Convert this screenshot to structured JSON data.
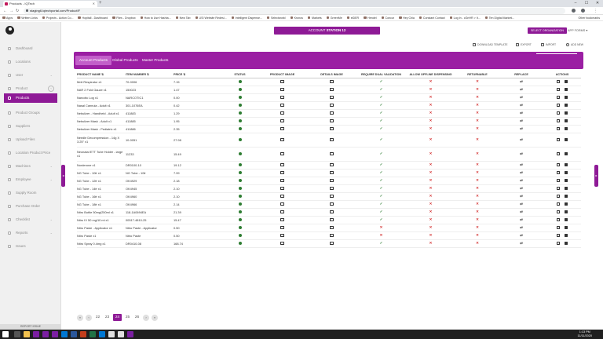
{
  "browser": {
    "tab_title": "Products - IQTech",
    "url": "staging6.iqtechportal.com/ProductIF",
    "bookmarks": [
      "Apps",
      "Written Links",
      "Projects - Action Co...",
      "Hopitall - Dashboard",
      "Files - Dropbox",
      "How to Use Hashta...",
      "New Tab",
      "USI Website Redesi...",
      "Intelligent Dispense...",
      "Selectworld",
      "Kronos",
      "Markets",
      "GreenMe",
      "eiDER",
      "Hendel",
      "Concur",
      "Hey Chia",
      "Constant Contact",
      "Log In - cGnHR > It...",
      "Ten Digital Marketi..."
    ],
    "other_bookmarks": "Other bookmarks"
  },
  "sidebar": {
    "items": [
      {
        "label": "Dashboard"
      },
      {
        "label": "Locations"
      },
      {
        "label": "User"
      },
      {
        "label": "Product"
      },
      {
        "label": "Products"
      },
      {
        "label": "Product Groups"
      },
      {
        "label": "Suppliers"
      },
      {
        "label": "Upload Files"
      },
      {
        "label": "Location Product Price"
      },
      {
        "label": "Machines"
      },
      {
        "label": "Employee"
      },
      {
        "label": "Supply Room"
      },
      {
        "label": "Purchase Order"
      },
      {
        "label": "Checklist"
      },
      {
        "label": "Reports"
      },
      {
        "label": "Issues"
      }
    ],
    "report_issue": "REPORT ISSUE"
  },
  "header": {
    "account_label": "ACCOUNT",
    "account_value": "STATION 12",
    "select_org": "SELECT ORGANIZATION",
    "app_forms": "APP FORMS ▾"
  },
  "toolbar": {
    "download": "DOWNLOAD TEMPLATE",
    "export": "EXPORT",
    "import": "IMPORT",
    "add_new": "ADD NEW"
  },
  "tabs": [
    "Account Products",
    "Global Products",
    "Master Products"
  ],
  "search_label": "Search",
  "columns": [
    "PRODUCT NAME ⇅",
    "ITEM NUMBER ⇅",
    "PRICE ⇅",
    "STATUS",
    "PRODUCT IMAGE",
    "DETAILS IMAGE",
    "REQUIRE DUAL VALIDATION",
    "ALLOW OFFLINE DISPENSING",
    "RETURNABLE",
    "REPLACE",
    "ACTIONS"
  ],
  "rows": [
    {
      "name": "Mntl Respirator x1",
      "item": "70-0006",
      "price": "7.15",
      "dual": true
    },
    {
      "name": "NAR 2 Fold Gauze x1",
      "item": "150023",
      "price": "1.47",
      "dual": true
    },
    {
      "name": "Narcotic Log x1",
      "item": "NARCOTIC1",
      "price": "0.00",
      "dual": true
    },
    {
      "name": "Nasal Cannula - Adult x1",
      "item": "301-1076EA",
      "price": "0.42",
      "dual": true
    },
    {
      "name": "Nebulizer - Handheld - Adult x1",
      "item": "411883",
      "price": "1.29",
      "dual": true
    },
    {
      "name": "Nebulizer Mask - Adult x1",
      "item": "411885",
      "price": "1.95",
      "dual": true
    },
    {
      "name": "Nebulizer Mask - Pediatric x1",
      "item": "411886",
      "price": "2.35",
      "dual": true
    },
    {
      "name": "Needle Decompression - 14g X 3.25\" x1",
      "item": "10-0051",
      "price": "27.98",
      "dual": true,
      "tall": true
    },
    {
      "name": "Neonatal ETT Tube Holder - large x1",
      "item": "11233",
      "price": "15.49",
      "dual": true,
      "tall": true
    },
    {
      "name": "Norderone x1",
      "item": "DR0100-10",
      "price": "19.12",
      "dual": true
    },
    {
      "name": "NG Tube - 10fr x1",
      "item": "NG Tube - 10fr",
      "price": "7.99",
      "dual": true
    },
    {
      "name": "NG Tube - 12fr x1",
      "item": "OK4929",
      "price": "2.18",
      "dual": true
    },
    {
      "name": "NG Tube - 14fr x1",
      "item": "OK4945",
      "price": "2.10",
      "dual": true
    },
    {
      "name": "NG Tube - 16fr x1",
      "item": "OK4960",
      "price": "2.10",
      "dual": true
    },
    {
      "name": "NG Tube - 18fr x1",
      "item": "OK4966",
      "price": "2.14",
      "dual": true
    },
    {
      "name": "Nitro Bottle 50mg/250ml x1",
      "item": "118-1A0694EA",
      "price": "21.39",
      "dual": true
    },
    {
      "name": "Nitro IV 50 mg/10 ml x1",
      "item": "00517-4810-25",
      "price": "15.47",
      "dual": true
    },
    {
      "name": "Nitro Paste - Applicator x1",
      "item": "Nitro Paste - Applicator",
      "price": "0.50",
      "dual": false
    },
    {
      "name": "Nitro Paste x1",
      "item": "Nitro Paste",
      "price": "0.50",
      "dual": false
    },
    {
      "name": "Nitro Spray 0.4mg x1",
      "item": "DR0410-08",
      "price": "168.74",
      "dual": true
    }
  ],
  "pager": {
    "pages": [
      "22",
      "23",
      "24",
      "25",
      "26"
    ],
    "current": "24",
    "first": "«",
    "prev": "‹",
    "next": "›",
    "last": "»"
  },
  "taskbar": {
    "time": "1:13 PM",
    "date": "11/11/2020"
  },
  "colors": {
    "accent": "#8e1a96",
    "status_ok": "#2e7d32",
    "no": "#d32f2f"
  }
}
